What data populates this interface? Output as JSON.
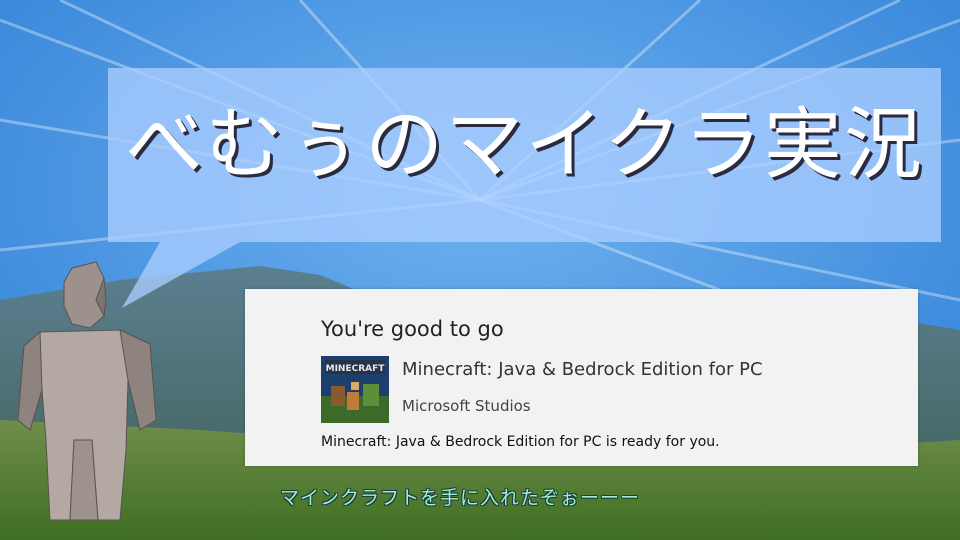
{
  "banner": {
    "title": "べむぅのマイクラ実況"
  },
  "store_card": {
    "heading": "You're good to go",
    "product_name": "Minecraft: Java & Bedrock Edition for PC",
    "publisher": "Microsoft Studios",
    "status_message": "Minecraft: Java & Bedrock Edition for PC is ready for you.",
    "icon": "minecraft-box-art",
    "icon_text": "MINECRAFT"
  },
  "caption": {
    "text": "マインクラフトを手に入れたぞぉーーー"
  },
  "colors": {
    "sky": "#3e8fe0",
    "banner": "#aacdff",
    "card": "#f2f2f2",
    "caption": "#9ff0d8",
    "mountain": "#4b6a7a",
    "grass": "#4f7a2e"
  }
}
